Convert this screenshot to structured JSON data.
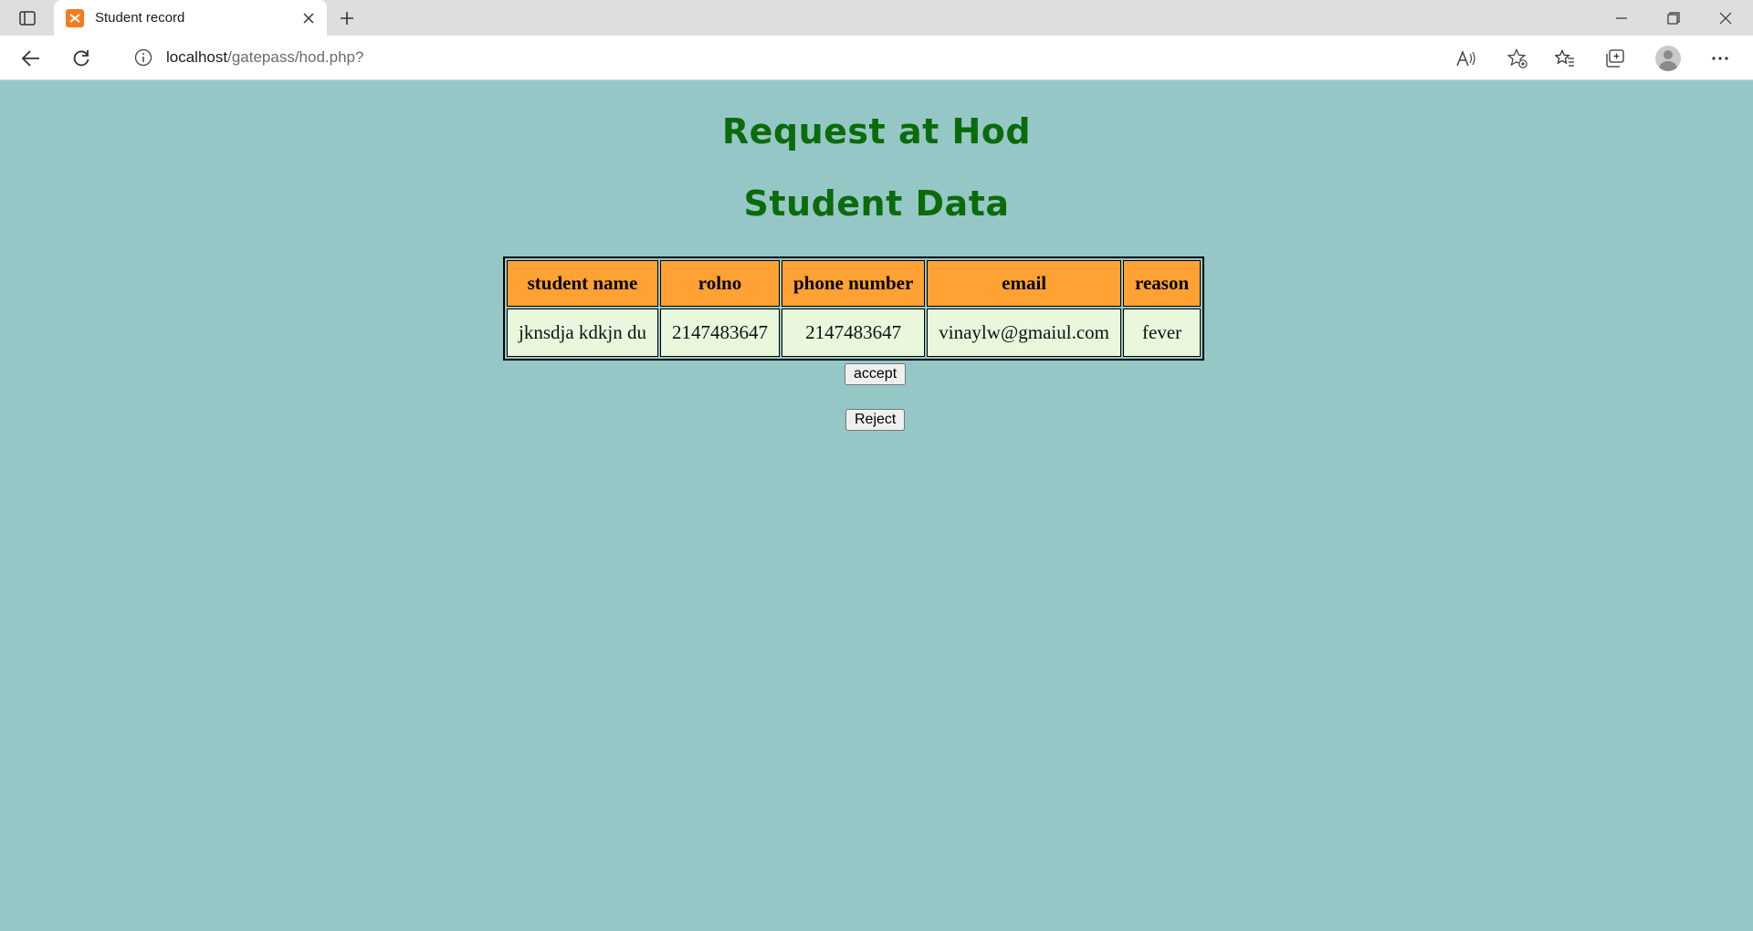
{
  "browser": {
    "tab_title": "Student record",
    "url_host": "localhost",
    "url_path": "/gatepass/hod.php?"
  },
  "page": {
    "heading": "Request at Hod",
    "subheading": "Student Data"
  },
  "table": {
    "headers": [
      "student name",
      "rolno",
      "phone number",
      "email",
      "reason"
    ],
    "rows": [
      [
        "jknsdja kdkjn du",
        "2147483647",
        "2147483647",
        "vinaylw@gmaiul.com",
        "fever"
      ]
    ]
  },
  "actions": {
    "accept_label": "accept",
    "reject_label": "Reject"
  },
  "colors": {
    "page_background": "#96c7c7",
    "heading": "#0b6b0b",
    "header_cell": "#ffa133",
    "data_cell": "#e9f8dc"
  }
}
